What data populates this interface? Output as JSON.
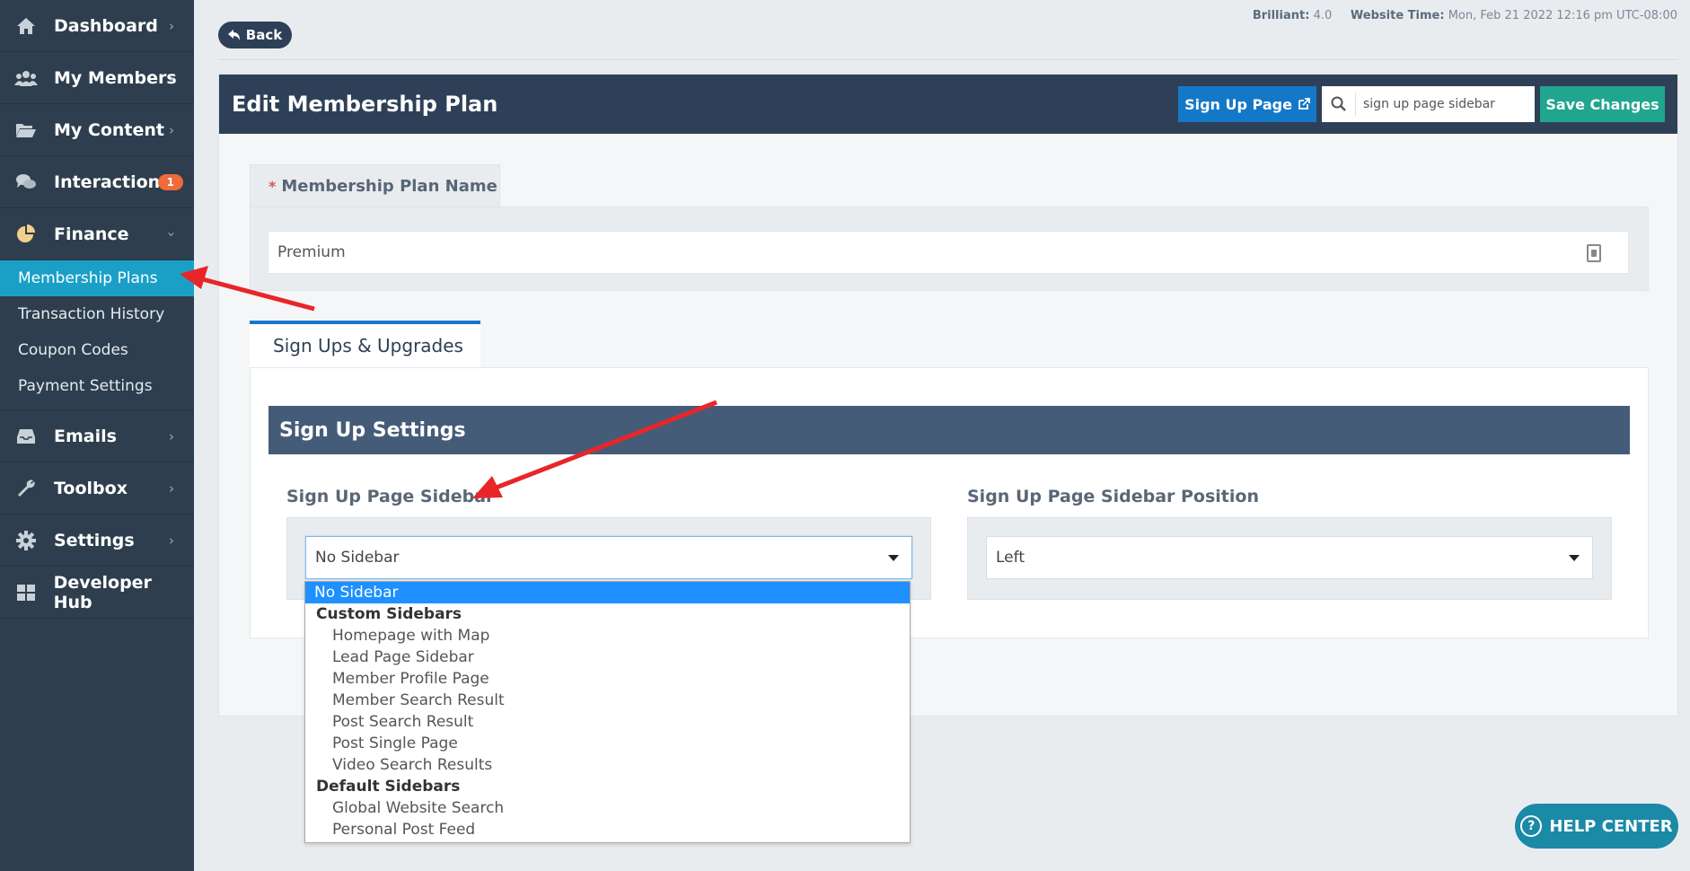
{
  "sidebar": {
    "items": [
      {
        "label": "Dashboard"
      },
      {
        "label": "My Members"
      },
      {
        "label": "My Content"
      },
      {
        "label": "Interactions",
        "badge": "1"
      },
      {
        "label": "Finance"
      },
      {
        "label": "Emails"
      },
      {
        "label": "Toolbox"
      },
      {
        "label": "Settings"
      },
      {
        "label": "Developer Hub"
      }
    ],
    "finance_sub": [
      {
        "label": "Membership Plans"
      },
      {
        "label": "Transaction History"
      },
      {
        "label": "Coupon Codes"
      },
      {
        "label": "Payment Settings"
      }
    ]
  },
  "topbar": {
    "back_label": "Back",
    "version_label": "Brilliant:",
    "version_value": "4.0",
    "time_label": "Website Time:",
    "time_value": "Mon, Feb 21 2022 12:16 pm UTC-08:00"
  },
  "header": {
    "title": "Edit Membership Plan",
    "signup_page_label": "Sign Up Page",
    "search_value": "sign up page sidebar",
    "save_label": "Save Changes"
  },
  "plan_name": {
    "required_mark": "*",
    "label": "Membership Plan Name",
    "value": "Premium"
  },
  "tabs": {
    "signups_label": "Sign Ups & Upgrades"
  },
  "signup_settings": {
    "section_title": "Sign Up Settings",
    "sidebar_label": "Sign Up Page Sidebar",
    "sidebar_value": "No Sidebar",
    "position_label": "Sign Up Page Sidebar Position",
    "position_value": "Left"
  },
  "dropdown": {
    "selected": "No Sidebar",
    "group1": "Custom Sidebars",
    "group1_items": [
      "Homepage with Map",
      "Lead Page Sidebar",
      "Member Profile Page",
      "Member Search Result",
      "Post Search Result",
      "Post Single Page",
      "Video Search Results"
    ],
    "group2": "Default Sidebars",
    "group2_items": [
      "Global Website Search",
      "Personal Post Feed"
    ]
  },
  "help": {
    "label": "HELP CENTER"
  },
  "colors": {
    "sidebar_bg": "#2e3e4e",
    "active_item": "#1aa0c7",
    "header_bg": "#2e4057",
    "primary_button": "#1478c9",
    "save_button": "#20a58f",
    "section_bar": "#455c78",
    "badge": "#f06a3a",
    "annotation_arrow": "#e8262a"
  }
}
